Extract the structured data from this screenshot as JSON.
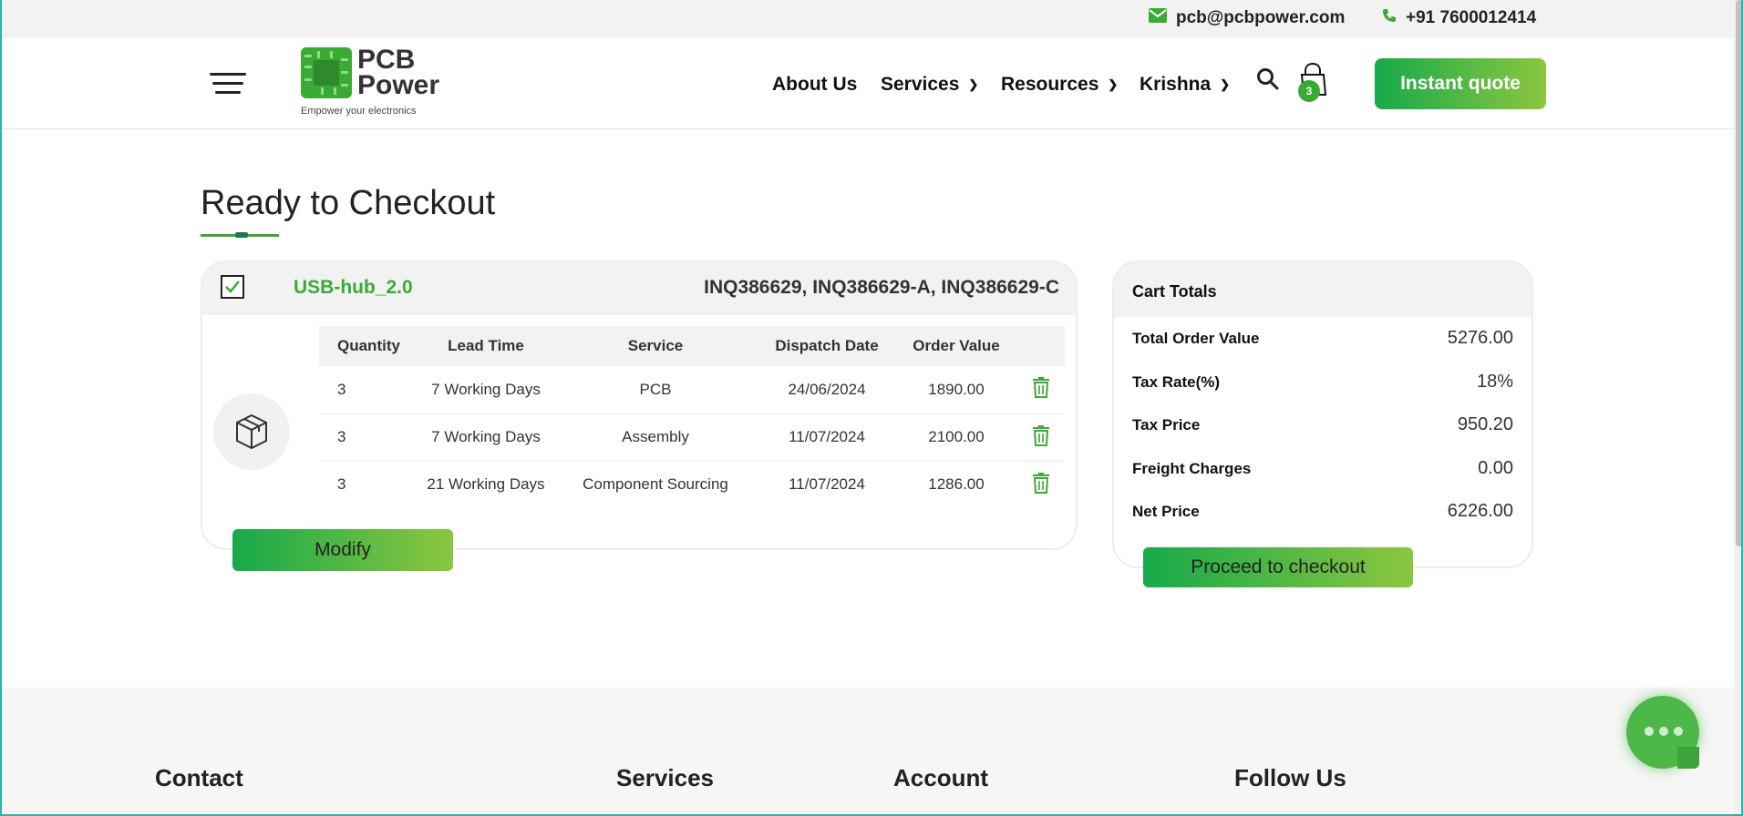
{
  "topbar": {
    "email": "pcb@pcbpower.com",
    "phone": "+91 7600012414"
  },
  "header": {
    "logo": {
      "name_line1": "PCB",
      "name_line2": "Power",
      "tagline": "Empower your electronics"
    },
    "nav": [
      {
        "label": "About Us",
        "has_dropdown": false
      },
      {
        "label": "Services",
        "has_dropdown": true
      },
      {
        "label": "Resources",
        "has_dropdown": true
      },
      {
        "label": "Krishna",
        "has_dropdown": true
      }
    ],
    "cart_count": "3",
    "quote_button": "Instant quote",
    "icons": [
      "menu-icon",
      "search-icon",
      "shopping-bag-icon"
    ]
  },
  "page": {
    "title": "Ready to Checkout"
  },
  "order": {
    "checked": true,
    "project_name": "USB-hub_2.0",
    "inquiry_ids": "INQ386629, INQ386629-A, INQ386629-C",
    "columns": [
      "Quantity",
      "Lead Time",
      "Service",
      "Dispatch Date",
      "Order Value"
    ],
    "rows": [
      {
        "quantity": "3",
        "lead_time": "7 Working Days",
        "service": "PCB",
        "dispatch_date": "24/06/2024",
        "order_value": "1890.00"
      },
      {
        "quantity": "3",
        "lead_time": "7 Working Days",
        "service": "Assembly",
        "dispatch_date": "11/07/2024",
        "order_value": "2100.00"
      },
      {
        "quantity": "3",
        "lead_time": "21 Working Days",
        "service": "Component Sourcing",
        "dispatch_date": "11/07/2024",
        "order_value": "1286.00"
      }
    ],
    "modify_button": "Modify"
  },
  "totals": {
    "title": "Cart Totals",
    "rows": [
      {
        "label": "Total Order Value",
        "value": "5276.00"
      },
      {
        "label": "Tax Rate(%)",
        "value": "18%"
      },
      {
        "label": "Tax Price",
        "value": "950.20"
      },
      {
        "label": "Freight Charges",
        "value": "0.00"
      },
      {
        "label": "Net Price",
        "value": "6226.00"
      }
    ],
    "checkout_button": "Proceed to checkout"
  },
  "footer": {
    "headings": [
      "Contact",
      "Services",
      "Account",
      "Follow Us"
    ]
  },
  "colors": {
    "brand_green": "#3aaa35",
    "gradient_start": "#17a94a",
    "gradient_end": "#8cc63f",
    "panel_gray": "#f1f2f1"
  }
}
